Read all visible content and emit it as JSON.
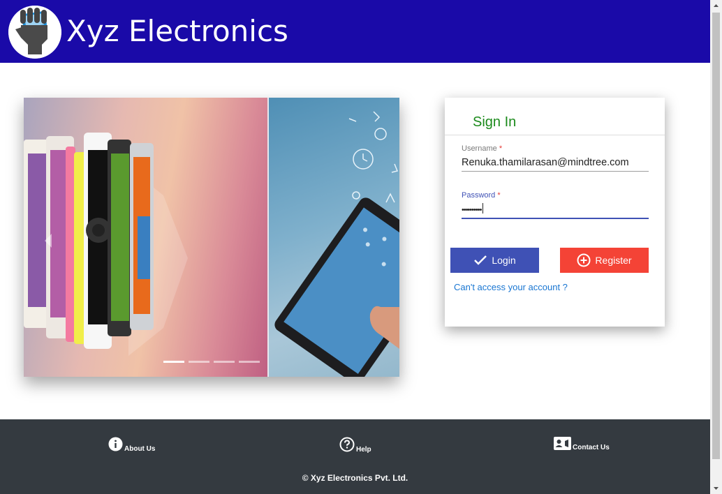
{
  "header": {
    "brand": "Xyz Electronics",
    "logo_icon": "hand-holding-phone-icon",
    "background_color": "#1a0aa8"
  },
  "carousel": {
    "indicator_count": 4,
    "active_index": 0
  },
  "login": {
    "title": "Sign In",
    "username": {
      "label": "Username",
      "required_mark": "*",
      "value": "Renuka.thamilarasan@mindtree.com"
    },
    "password": {
      "label": "Password",
      "required_mark": "*",
      "masked_value": "••••••••••"
    },
    "login_button": "Login",
    "register_button": "Register",
    "forgot_link": "Can't access your account ?",
    "colors": {
      "title": "#1b8a1b",
      "login": "#3f51b5",
      "register": "#f44336",
      "link": "#1976d2"
    }
  },
  "footer": {
    "about": "About Us",
    "help": "Help",
    "contact": "Contact Us",
    "copyright": "© Xyz Electronics Pvt. Ltd.",
    "icons": [
      "info-icon",
      "help-icon",
      "contact-card-icon"
    ]
  }
}
